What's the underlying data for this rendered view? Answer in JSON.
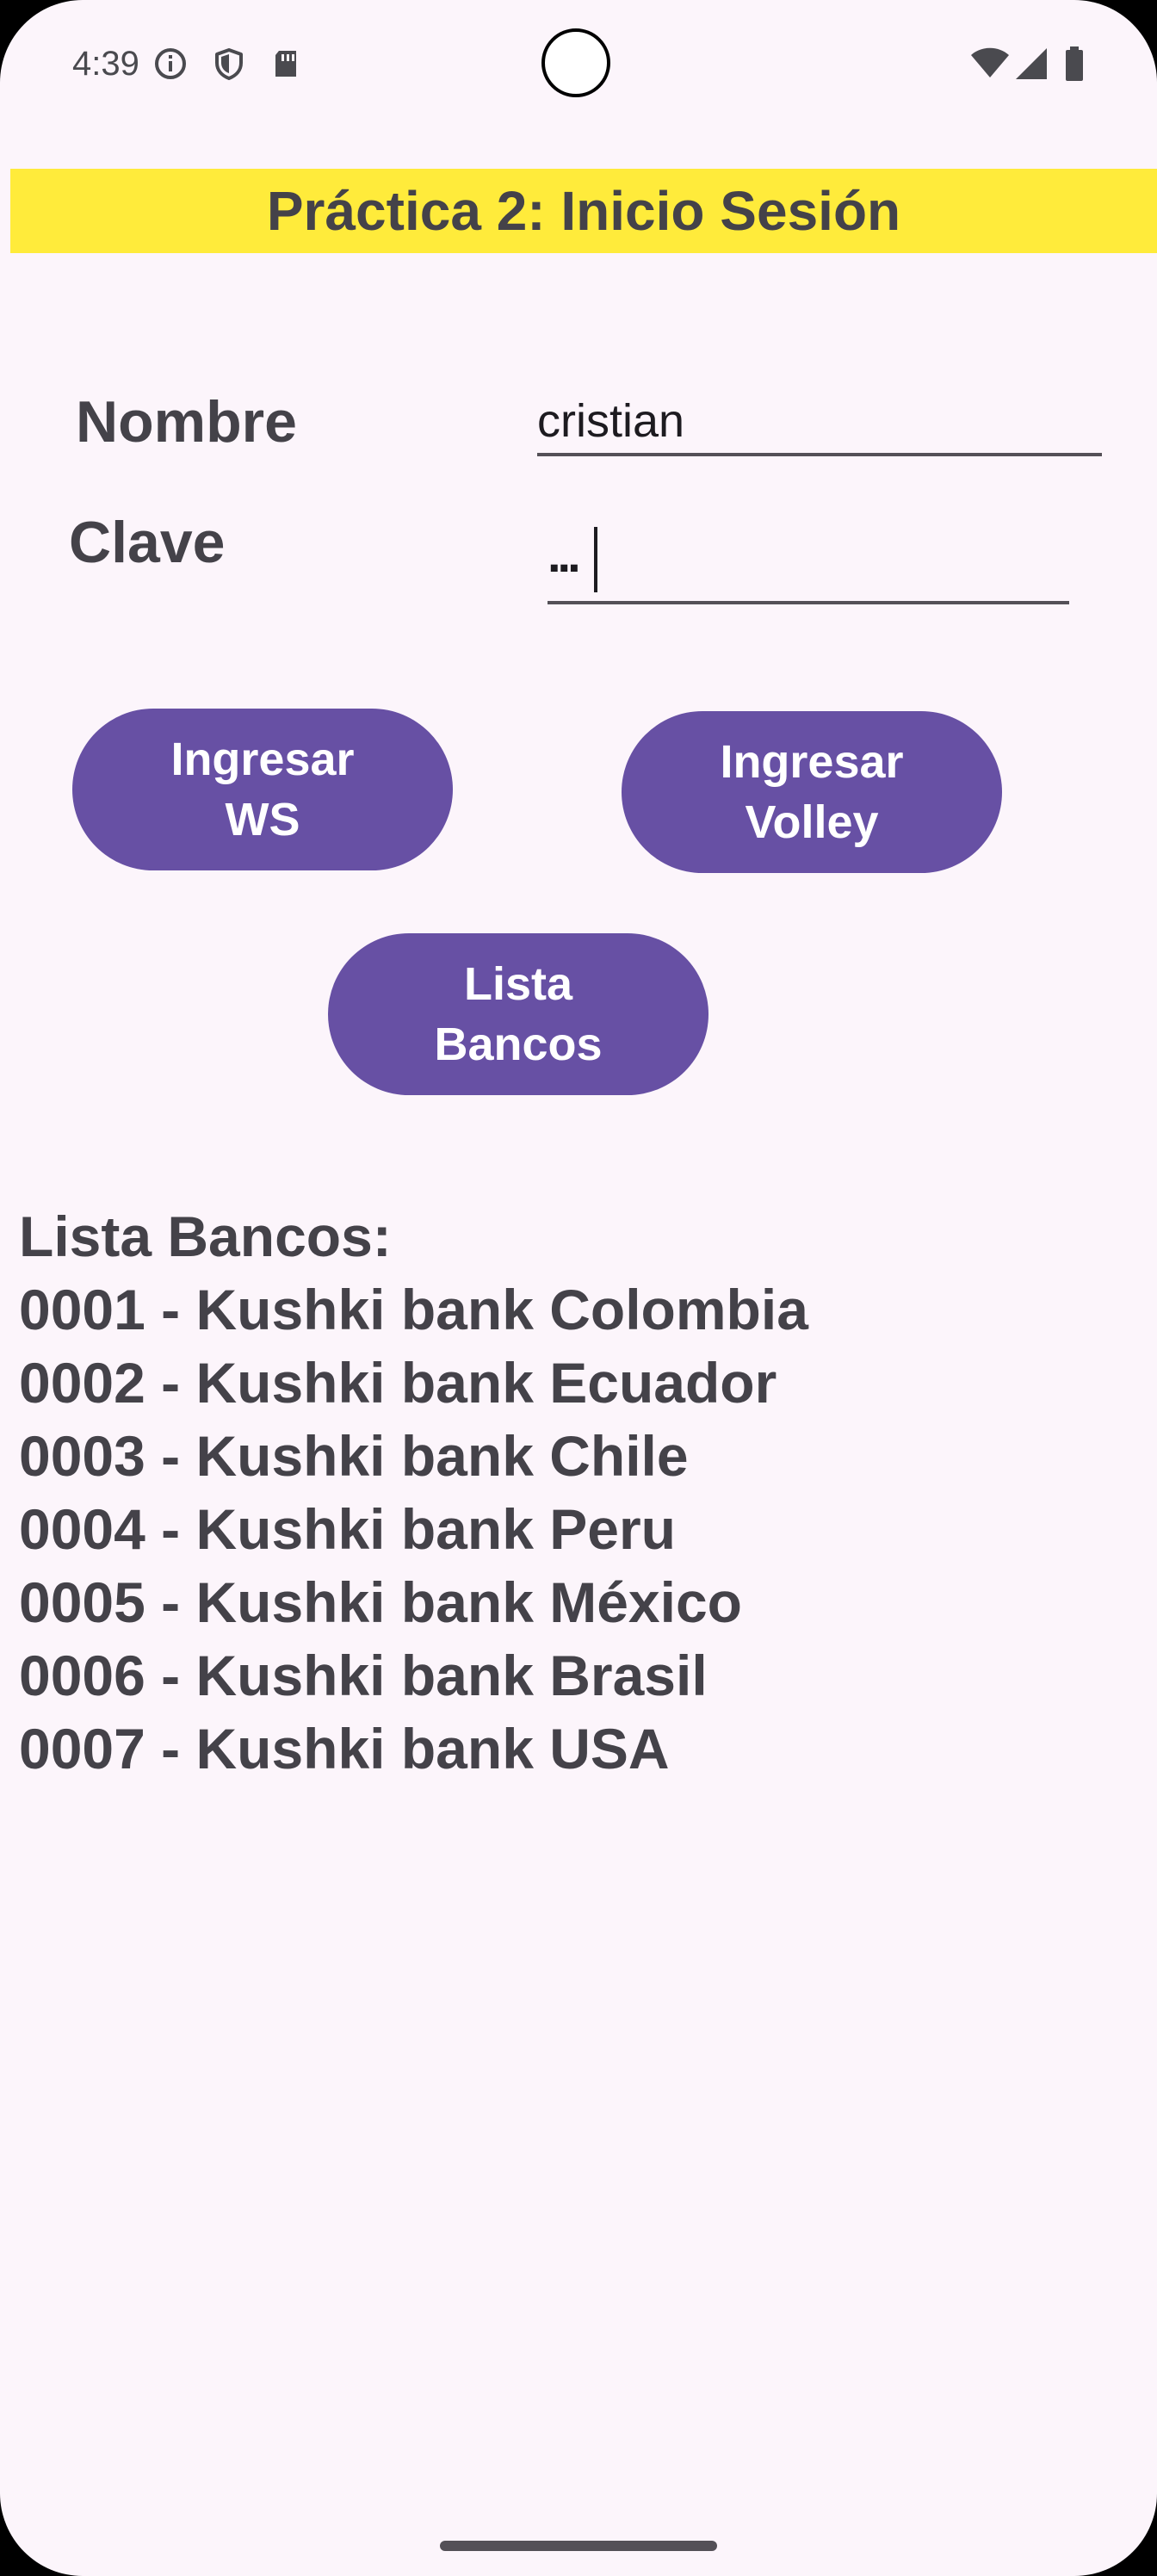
{
  "status_bar": {
    "time": "4:39",
    "left_icons": [
      "info-icon",
      "shield-icon",
      "sd-card-icon"
    ],
    "right_icons": [
      "wifi-icon",
      "cell-signal-icon",
      "battery-icon"
    ]
  },
  "app": {
    "title": "Práctica 2: Inicio Sesión",
    "title_bg_color": "#ffeb3b",
    "accent_color": "#6750a4"
  },
  "form": {
    "nombre_label": "Nombre",
    "nombre_value": "cristian",
    "clave_label": "Clave",
    "clave_masked": "..."
  },
  "buttons": {
    "ingresar_ws": "Ingresar\nWS",
    "ingresar_volley": "Ingresar\nVolley",
    "lista_bancos": "Lista\nBancos"
  },
  "bank_list": {
    "header": "Lista Bancos:",
    "items": [
      "0001 - Kushki bank Colombia",
      "0002 - Kushki bank Ecuador",
      "0003 - Kushki bank Chile",
      "0004 - Kushki bank Peru",
      "0005 - Kushki bank México",
      "0006 - Kushki bank Brasil",
      "0007 - Kushki bank USA"
    ]
  }
}
